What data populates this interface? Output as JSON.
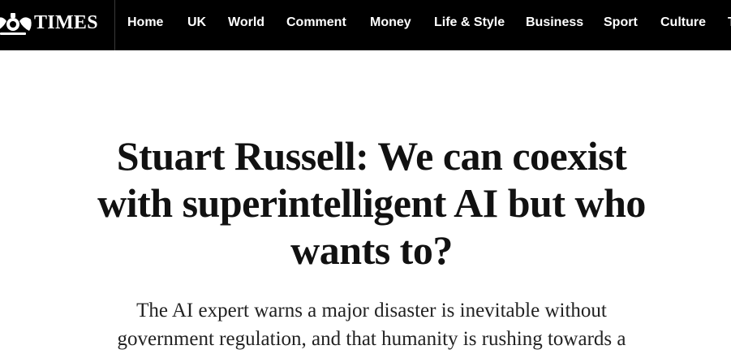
{
  "masthead": {
    "logo_text": "TIMES",
    "crest_icon": "royal-crest-icon"
  },
  "nav": {
    "items": [
      {
        "label": "Home"
      },
      {
        "label": "UK"
      },
      {
        "label": "World"
      },
      {
        "label": "Comment"
      },
      {
        "label": "Money"
      },
      {
        "label": "Life & Style"
      },
      {
        "label": "Business"
      },
      {
        "label": "Sport"
      },
      {
        "label": "Culture"
      },
      {
        "label": "T"
      }
    ]
  },
  "article": {
    "headline": "Stuart Russell: We can coexist with superintelligent AI but who wants to?",
    "standfirst": "The AI expert warns a major disaster is inevitable without government regulation, and that humanity is rushing towards a"
  },
  "colors": {
    "topbar_bg": "#000000",
    "nav_text": "#ffffff",
    "headline_text": "#111111",
    "page_bg": "#ffffff"
  }
}
